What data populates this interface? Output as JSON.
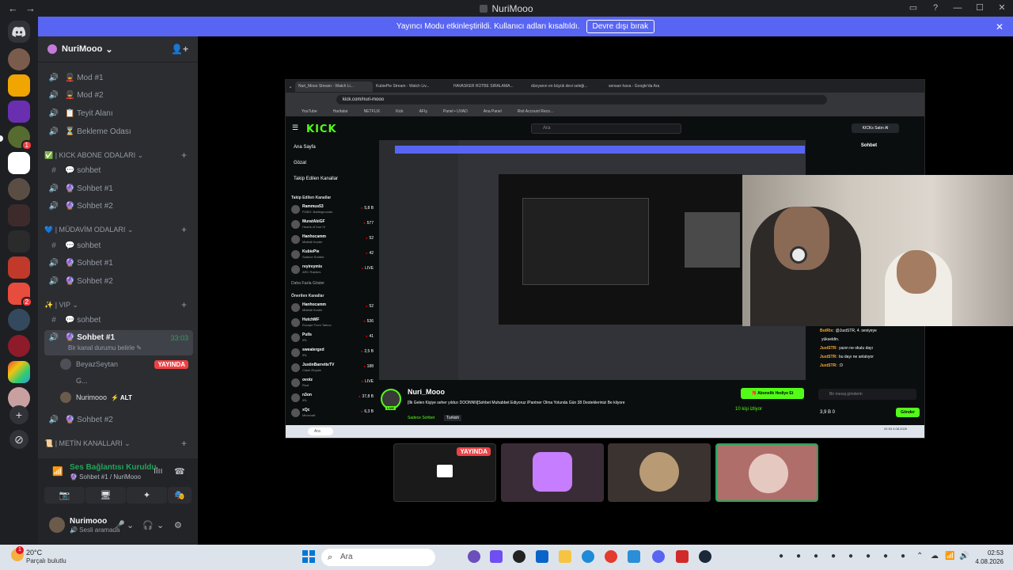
{
  "window": {
    "title": "NuriMooo",
    "back": "←",
    "forward": "→",
    "controls": [
      "▭",
      "?",
      "—",
      "☐",
      "✕"
    ]
  },
  "banner": {
    "text": "Yayıncı Modu etkinleştirildi. Kullanıcı adları kısaltıldı.",
    "button": "Devre dışı bırak",
    "close": "✕"
  },
  "colors": {
    "accent": "#5865f2",
    "online": "#23a55a",
    "live": "#ed4245",
    "kick": "#53fc18"
  },
  "server": {
    "name": "NuriMooo",
    "chevron": "⌄",
    "add_user_icon": "👤+"
  },
  "channels": [
    {
      "icon": "🔊",
      "label": "💂 Mod #1"
    },
    {
      "icon": "🔊",
      "label": "💂 Mod #2"
    },
    {
      "icon": "🔊",
      "label": "📋 Teyit Alanı"
    },
    {
      "icon": "🔊",
      "label": "⏳ Bekleme Odası"
    }
  ],
  "categories": [
    {
      "label": "✅ | KICK ABONE ODALARI ⌄",
      "plus": "+"
    },
    {
      "label": "💙 | MÜDAVİM ODALARI ⌄",
      "plus": "+"
    },
    {
      "label": "✨ | VIP ⌄",
      "plus": "+"
    },
    {
      "label": "📜 | METİN KANALLARI ⌄",
      "plus": "+"
    }
  ],
  "kick_channels": [
    {
      "icon": "#",
      "label": "💬 sohbet"
    },
    {
      "icon": "🔊",
      "label": "🔮 Sohbet #1"
    },
    {
      "icon": "🔊",
      "label": "🔮 Sohbet #2"
    }
  ],
  "mudavim_channels": [
    {
      "icon": "#",
      "label": "💬 sohbet"
    },
    {
      "icon": "🔊",
      "label": "🔮 Sohbet #1"
    },
    {
      "icon": "🔊",
      "label": "🔮 Sohbet #2"
    }
  ],
  "vip_channels": [
    {
      "icon": "#",
      "label": "💬 sohbet"
    },
    {
      "icon": "🔊",
      "label": "🔮 Sohbet #1",
      "timer": "33:03",
      "status": "Bir kanal durumu belirle ✎"
    },
    {
      "icon": "🔊",
      "label": "🔮 Sohbet #2"
    }
  ],
  "voice_users": [
    {
      "name": "BeyazSeytan",
      "badge": "YAYINDA"
    },
    {
      "name": "G..."
    },
    {
      "name": "Nurimooo",
      "alt": "⚡ ALT"
    }
  ],
  "voice": {
    "title": "Ses Bağlantısı Kuruldu",
    "sub": "🔮 Sohbet #1 / NuriMooo",
    "signal_icon": "📶",
    "wave_icon": "ılıı",
    "leave_icon": "☎",
    "buttons": [
      "📷",
      "🖥",
      "✦",
      "🎭"
    ]
  },
  "user": {
    "name": "Nurimooo",
    "status": "🔊 Sesli aramada",
    "mic": "🎤",
    "chev": "⌄",
    "head": "🎧",
    "gear": "⚙"
  },
  "guild_badges": {
    "b1": "1",
    "b2": "2"
  },
  "guild_add": "+",
  "guild_explore": "⊘",
  "stream": {
    "tabs": [
      "Nuri_Mooo Stream - Watch Li...",
      "KubiePie Stream - Watch Liv...",
      "HAVASKER RÜTBE SIRALAMA...",
      "dünyanın en büyük devi seleği...",
      "sensan hava - Google'da Ara"
    ],
    "url": "kick.com/nuri-mooo",
    "bookmarks": [
      "YouTube",
      "Haritalar",
      "NETFLIX",
      "Kick",
      "AFIş",
      "Panel • UVAD",
      "Ana Panel",
      "Riot Account Reco..."
    ],
    "search": "Ara",
    "buy": "KICKs Satın Al",
    "nav": [
      "Ana Sayfa",
      "Gözat",
      "Takip Edilen Kanallar"
    ],
    "followed_title": "Takip Edilen Kanallar",
    "recommended_title": "Önerilen Kanallar",
    "more": "Daha Fazla Göster",
    "followed": [
      {
        "name": "Rammus53",
        "game": "PUBG: Battlegrounds",
        "viewers": "5,8 B"
      },
      {
        "name": "MuratAbiGF",
        "game": "Hearts of Iron IV",
        "viewers": "577"
      },
      {
        "name": "Hanhocamm",
        "game": "Mistfall Hunter",
        "viewers": "52"
      },
      {
        "name": "KubiePie",
        "game": "Sadece Sohbet",
        "viewers": "42"
      },
      {
        "name": "reyireymis",
        "game": "ARC Raiders",
        "viewers": "LIVE"
      }
    ],
    "recommended": [
      {
        "name": "Hanhocamm",
        "game": "Mistfall Hunter",
        "viewers": "52"
      },
      {
        "name": "HutchMF",
        "game": "Escape From Tarkov",
        "viewers": "536"
      },
      {
        "name": "Pulls",
        "game": "IRL",
        "viewers": "41"
      },
      {
        "name": "sweatergxd",
        "game": "IRL",
        "viewers": "2,5 B"
      },
      {
        "name": "JustinBarretteTV",
        "game": "Clash Royale",
        "viewers": "188"
      },
      {
        "name": "ovotz",
        "game": "Rust",
        "viewers": "LIVE"
      },
      {
        "name": "n3on",
        "game": "IRL",
        "viewers": "37,8 B"
      },
      {
        "name": "xQc",
        "game": "Minecraft",
        "viewers": "6,3 B"
      }
    ],
    "chat_title": "Sohbet",
    "chat": [
      {
        "user": "BotRix:",
        "text": "@JustSTR, 4. seviyeye"
      },
      {
        "user": "",
        "text": "yükseldin."
      },
      {
        "user": "JustSTR:",
        "text": "yazın ne okulu dayı"
      },
      {
        "user": "JustSTR:",
        "text": "bu dayı ne anlatıyor"
      },
      {
        "user": "JustSTR:",
        "text": ":D"
      }
    ],
    "chat_input": "Bir mesaj gönderin",
    "send": "Gönder",
    "points": "3,9 B   0",
    "streamer": "Nuri_Mooo",
    "live_tag": "LIVE",
    "title": "[İlk Gelen Kişiye seher yıldızı DOONNN]Sohbet Muhabbet Ediyoruz /Pantner Olma Yolunda Gün 38 Desteklerinizi Be kliyore",
    "category": "Sadece Sohbet",
    "tag": "Turkish",
    "sub_btn": "🎁 Abonelik Hediye Et",
    "viewers": "10 kişi izliyor",
    "win_search": "Ara",
    "win_clock": "02:53 4.08.2026"
  },
  "thumbs": [
    {
      "badge": "YAYINDA"
    }
  ],
  "taskbar": {
    "temp": "20°C",
    "weather": "Parçalı bulutlu",
    "notif": "1",
    "search": "Ara",
    "search_icon": "⌕",
    "time": "02:53",
    "date": "4.08.2026",
    "tray": [
      "⌃",
      "☁",
      "📶",
      "🔊"
    ]
  }
}
